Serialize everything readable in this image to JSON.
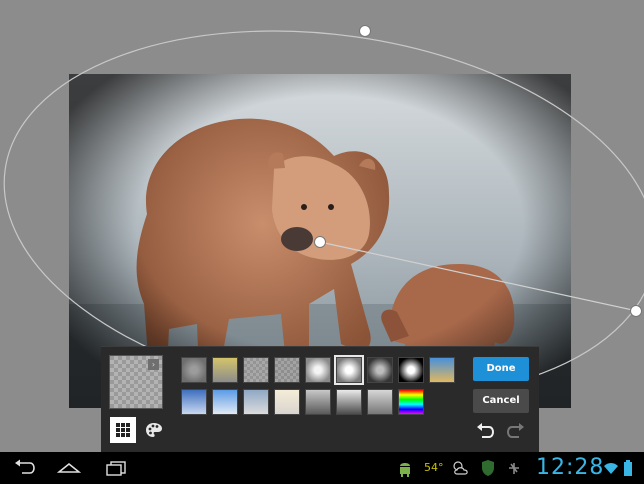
{
  "editor": {
    "done_label": "Done",
    "cancel_label": "Cancel",
    "preview_arrow": "›",
    "swatches": [
      {
        "id": "vignette-soft",
        "type": "radial",
        "inner": "#9c9c9c",
        "outer": "#6e6e6e"
      },
      {
        "id": "warm-gold",
        "type": "linear",
        "inner": "#d3c46a",
        "outer": "#8c8c8c"
      },
      {
        "id": "checker-light",
        "type": "checker",
        "inner": "#a8a8a8",
        "outer": "#949494"
      },
      {
        "id": "checker-mid",
        "type": "checker",
        "inner": "#a3a3a3",
        "outer": "#8e8e8e"
      },
      {
        "id": "radial-white-soft",
        "type": "radial",
        "inner": "#f4f4f4",
        "outer": "#8a8a8a"
      },
      {
        "id": "radial-white-selected",
        "type": "radial",
        "inner": "#ffffff",
        "outer": "#7a7a7a",
        "selected": true
      },
      {
        "id": "radial-dark",
        "type": "radial",
        "inner": "#bdbdbd",
        "outer": "#353535"
      },
      {
        "id": "radial-black",
        "type": "radial",
        "inner": "#ffffff",
        "outer": "#000000"
      },
      {
        "id": "sky-sand",
        "type": "linear",
        "inner": "#4a90d9",
        "outer": "#e0b860"
      },
      {
        "id": "blue-fade",
        "type": "linear",
        "inner": "#3f6fbf",
        "outer": "#c9d8ef"
      },
      {
        "id": "light-blue-fade",
        "type": "linear",
        "inner": "#5b9be6",
        "outer": "#e2eaf4"
      },
      {
        "id": "steel-fade",
        "type": "linear",
        "inner": "#8fa8c4",
        "outer": "#dcdcdc"
      },
      {
        "id": "cream-fade",
        "type": "linear",
        "inner": "#f5ecd8",
        "outer": "#d9d5cf"
      },
      {
        "id": "gray-band",
        "type": "linear",
        "inner": "#c8c8c8",
        "outer": "#5a5a5a"
      },
      {
        "id": "gray-dark-band",
        "type": "linear",
        "inner": "#eaeaea",
        "outer": "#4c4c4c"
      },
      {
        "id": "gray-soft-band",
        "type": "linear",
        "inner": "#d7d7d7",
        "outer": "#777777"
      },
      {
        "id": "rainbow",
        "type": "rainbow",
        "inner": "#ff0000",
        "outer": "#0000ff"
      }
    ],
    "colors": {
      "accent": "#1e90d8",
      "panel": "#2a2a2a",
      "clock": "#39b6e6",
      "temperature": "#c7c100"
    }
  },
  "statusbar": {
    "temperature": "54°",
    "time": "12:28"
  },
  "icons": {
    "back": "back-icon",
    "home": "home-icon",
    "recent": "recent-apps-icon",
    "android": "android-icon",
    "weather": "weather-icon",
    "shield": "shield-icon",
    "usb": "usb-icon",
    "wifi": "wifi-icon",
    "battery": "battery-icon",
    "grid": "grid-icon",
    "palette": "palette-icon",
    "undo": "undo-icon",
    "redo": "redo-icon"
  }
}
